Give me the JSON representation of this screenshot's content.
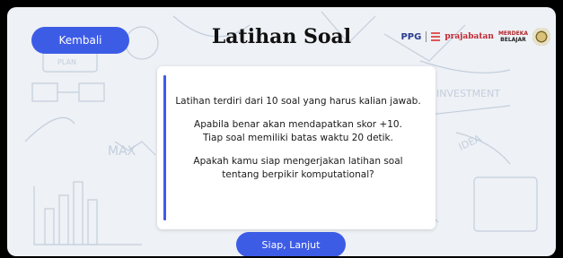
{
  "header": {
    "back_label": "Kembali",
    "title": "Latihan Soal",
    "logos": {
      "ppg": "PPG",
      "prajabatan": "prajabatan",
      "merdeka_top": "MERDEKA",
      "merdeka_bottom": "BELAJAR"
    }
  },
  "card": {
    "line1": "Latihan terdiri dari 10 soal yang harus kalian jawab.",
    "line2a": "Apabila benar akan  mendapatkan skor +10.",
    "line2b": "Tiap soal memiliki batas waktu 20 detik.",
    "line3a": "Apakah kamu siap mengerjakan latihan soal",
    "line3b": "tentang berpikir komputational?"
  },
  "footer": {
    "next_label": "Siap, Lanjut"
  },
  "colors": {
    "accent": "#3d5ce6",
    "background": "#eef1f5"
  }
}
